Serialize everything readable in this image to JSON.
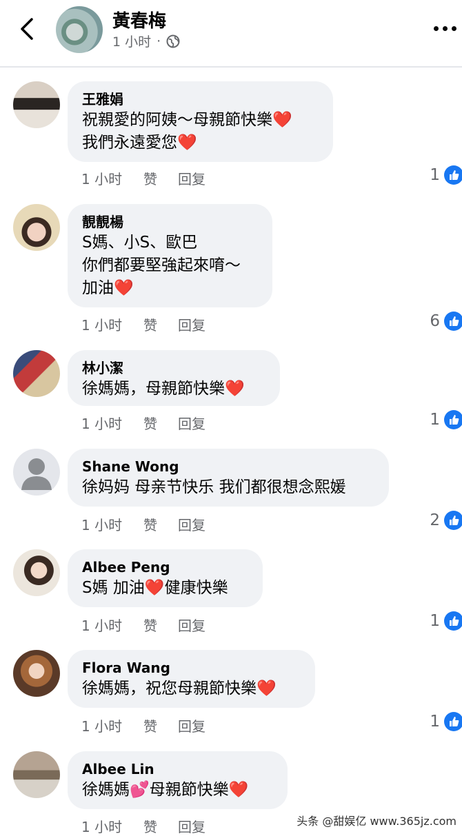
{
  "header": {
    "name": "黃春梅",
    "time": "1 小时",
    "dot": "·",
    "icons": [
      "back-icon",
      "globe-icon",
      "more-icon"
    ]
  },
  "comments": [
    {
      "author": "王雅娟",
      "lines": [
        "祝親愛的阿姨～母親節快樂",
        "我們永遠愛您"
      ],
      "time": "1 小时",
      "like": "赞",
      "reply": "回复",
      "count": "1"
    },
    {
      "author": "靚靚楊",
      "lines": [
        "S媽、小S、歐巴",
        "你們都要堅強起來唷～",
        "加油"
      ],
      "time": "1 小时",
      "like": "赞",
      "reply": "回复",
      "count": "6"
    },
    {
      "author": "林小潔",
      "lines": [
        "徐媽媽，母親節快樂"
      ],
      "time": "1 小时",
      "like": "赞",
      "reply": "回复",
      "count": "1"
    },
    {
      "author": "Shane Wong",
      "lines": [
        "徐妈妈 母亲节快乐 我们都很想念熙媛"
      ],
      "time": "1 小时",
      "like": "赞",
      "reply": "回复",
      "count": "2"
    },
    {
      "author": "Albee Peng",
      "lines": [
        "S媽 加油",
        "健康快樂"
      ],
      "time": "1 小时",
      "like": "赞",
      "reply": "回复",
      "count": "1"
    },
    {
      "author": "Flora Wang",
      "lines": [
        "徐媽媽，祝您母親節快樂"
      ],
      "time": "1 小时",
      "like": "赞",
      "reply": "回复",
      "count": "1"
    },
    {
      "author": "Albee Lin",
      "lines": [
        "徐媽媽",
        "母親節快樂"
      ],
      "time": "1 小时",
      "like": "赞",
      "reply": "回复",
      "count": ""
    }
  ],
  "emoji": {
    "heart": "❤️",
    "hearts": "💕"
  },
  "watermark": "头条 @甜娱亿 www.365jz.com",
  "colors": {
    "accent": "#1877f2",
    "bubble": "#f0f2f5",
    "meta": "#65676b"
  }
}
